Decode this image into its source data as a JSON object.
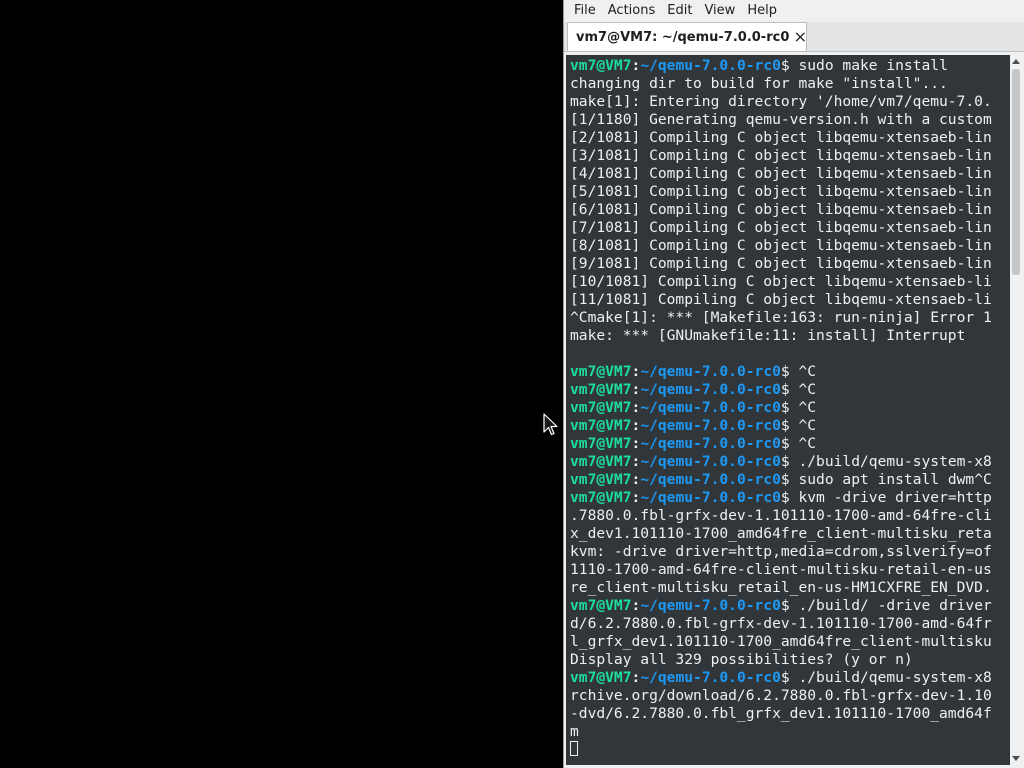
{
  "menubar": {
    "items": [
      {
        "label": "File"
      },
      {
        "label": "Actions"
      },
      {
        "label": "Edit"
      },
      {
        "label": "View"
      },
      {
        "label": "Help"
      }
    ]
  },
  "tab": {
    "title": "vm7@VM7: ~/qemu-7.0.0-rc0"
  },
  "prompt": {
    "user": "vm7@VM7",
    "colon": ":",
    "path": "~/qemu-7.0.0-rc0",
    "dollar": "$"
  },
  "terminal": {
    "lines": [
      {
        "prompt": true,
        "text": " sudo make install"
      },
      {
        "prompt": false,
        "text": "changing dir to build for make \"install\"..."
      },
      {
        "prompt": false,
        "text": "make[1]: Entering directory '/home/vm7/qemu-7.0."
      },
      {
        "prompt": false,
        "text": "[1/1180] Generating qemu-version.h with a custom"
      },
      {
        "prompt": false,
        "text": "[2/1081] Compiling C object libqemu-xtensaeb-lin"
      },
      {
        "prompt": false,
        "text": "[3/1081] Compiling C object libqemu-xtensaeb-lin"
      },
      {
        "prompt": false,
        "text": "[4/1081] Compiling C object libqemu-xtensaeb-lin"
      },
      {
        "prompt": false,
        "text": "[5/1081] Compiling C object libqemu-xtensaeb-lin"
      },
      {
        "prompt": false,
        "text": "[6/1081] Compiling C object libqemu-xtensaeb-lin"
      },
      {
        "prompt": false,
        "text": "[7/1081] Compiling C object libqemu-xtensaeb-lin"
      },
      {
        "prompt": false,
        "text": "[8/1081] Compiling C object libqemu-xtensaeb-lin"
      },
      {
        "prompt": false,
        "text": "[9/1081] Compiling C object libqemu-xtensaeb-lin"
      },
      {
        "prompt": false,
        "text": "[10/1081] Compiling C object libqemu-xtensaeb-li"
      },
      {
        "prompt": false,
        "text": "[11/1081] Compiling C object libqemu-xtensaeb-li"
      },
      {
        "prompt": false,
        "text": "^Cmake[1]: *** [Makefile:163: run-ninja] Error 1"
      },
      {
        "prompt": false,
        "text": "make: *** [GNUmakefile:11: install] Interrupt"
      },
      {
        "prompt": false,
        "text": ""
      },
      {
        "prompt": true,
        "text": " ^C"
      },
      {
        "prompt": true,
        "text": " ^C"
      },
      {
        "prompt": true,
        "text": " ^C"
      },
      {
        "prompt": true,
        "text": " ^C"
      },
      {
        "prompt": true,
        "text": " ^C"
      },
      {
        "prompt": true,
        "text": " ./build/qemu-system-x8"
      },
      {
        "prompt": true,
        "text": " sudo apt install dwm^C"
      },
      {
        "prompt": true,
        "text": " kvm -drive driver=http"
      },
      {
        "prompt": false,
        "text": ".7880.0.fbl-grfx-dev-1.101110-1700-amd-64fre-cli"
      },
      {
        "prompt": false,
        "text": "x_dev1.101110-1700_amd64fre_client-multisku_reta"
      },
      {
        "prompt": false,
        "text": "kvm: -drive driver=http,media=cdrom,sslverify=of"
      },
      {
        "prompt": false,
        "text": "1110-1700-amd-64fre-client-multisku-retail-en-us"
      },
      {
        "prompt": false,
        "text": "re_client-multisku_retail_en-us-HM1CXFRE_EN_DVD."
      },
      {
        "prompt": true,
        "text": " ./build/ -drive driver"
      },
      {
        "prompt": false,
        "text": "d/6.2.7880.0.fbl-grfx-dev-1.101110-1700-amd-64fr"
      },
      {
        "prompt": false,
        "text": "l_grfx_dev1.101110-1700_amd64fre_client-multisku"
      },
      {
        "prompt": false,
        "text": "Display all 329 possibilities? (y or n)"
      },
      {
        "prompt": true,
        "text": " ./build/qemu-system-x8"
      },
      {
        "prompt": false,
        "text": "rchive.org/download/6.2.7880.0.fbl-grfx-dev-1.10"
      },
      {
        "prompt": false,
        "text": "-dvd/6.2.7880.0.fbl_grfx_dev1.101110-1700_amd64f"
      },
      {
        "prompt": false,
        "text": "m"
      }
    ]
  },
  "colors": {
    "terminal_bg": "#31363b",
    "terminal_fg": "#eff0f1",
    "prompt_user": "#1cdc9a",
    "prompt_path": "#1d99f3",
    "window_bg": "#eff0f1"
  },
  "icons": {
    "tab_close": "close-icon",
    "mouse_cursor": "mouse-pointer-icon",
    "text_cursor": "block-cursor"
  }
}
